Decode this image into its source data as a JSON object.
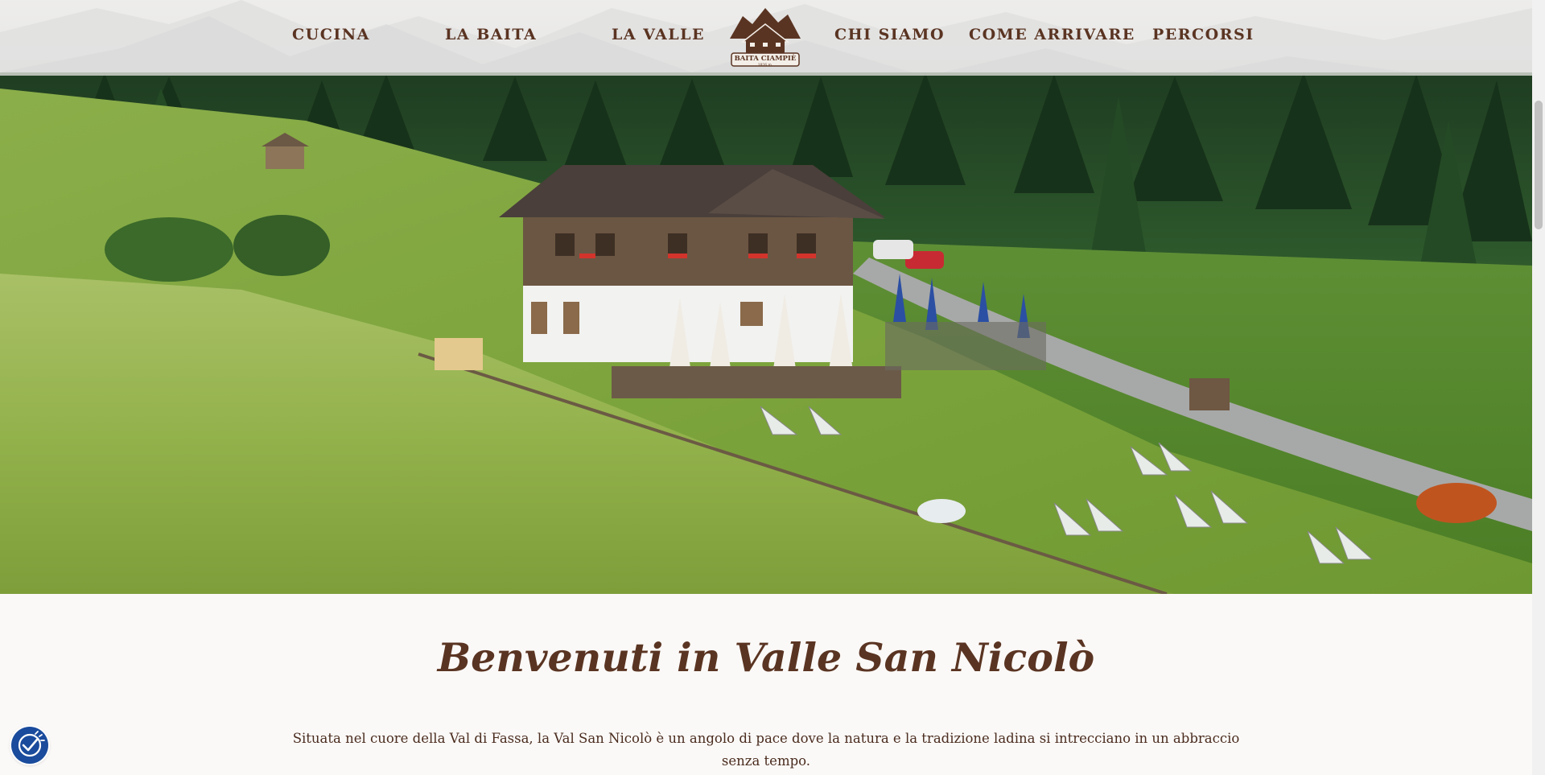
{
  "nav": {
    "left_items": [
      "CUCINA",
      "LA BAITA",
      "LA VALLE"
    ],
    "right_items": [
      "CHI SIAMO",
      "COME ARRIVARE",
      "PERCORSI"
    ],
    "logo_text": "BAITA CIAMPIÈ",
    "logo_altitude": "1826 m."
  },
  "hero": {
    "image": "photo-mountain-hut-meadow"
  },
  "welcome": {
    "title": "Benvenuti in Valle San Nicolò",
    "intro": "Situata nel cuore della Val di Fassa, la Val San Nicolò è un angolo di pace dove la natura e la tradizione ladina si intrecciano in un abbraccio senza tempo."
  },
  "colors": {
    "brand_brown": "#5a3422",
    "accessibility_blue": "#1a4b9c",
    "background": "#fbf9f7"
  },
  "icons": {
    "accessibility": "accessibility-icon"
  }
}
